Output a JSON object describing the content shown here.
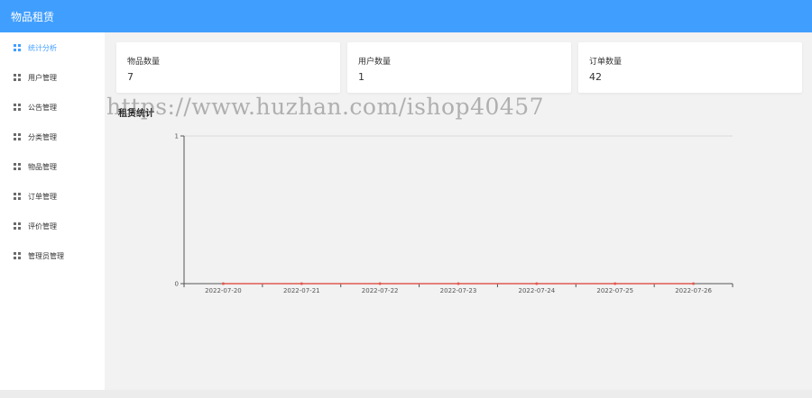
{
  "header": {
    "title": "物品租赁"
  },
  "sidebar": {
    "items": [
      {
        "label": "统计分析",
        "active": true,
        "icon": "grid-icon"
      },
      {
        "label": "用户管理",
        "active": false,
        "icon": "grid-icon"
      },
      {
        "label": "公告管理",
        "active": false,
        "icon": "grid-icon"
      },
      {
        "label": "分类管理",
        "active": false,
        "icon": "grid-icon"
      },
      {
        "label": "物品管理",
        "active": false,
        "icon": "grid-icon"
      },
      {
        "label": "订单管理",
        "active": false,
        "icon": "grid-icon"
      },
      {
        "label": "评价管理",
        "active": false,
        "icon": "grid-icon"
      },
      {
        "label": "管理员管理",
        "active": false,
        "icon": "grid-icon"
      }
    ]
  },
  "stats": [
    {
      "label": "物品数量",
      "value": "7"
    },
    {
      "label": "用户数量",
      "value": "1"
    },
    {
      "label": "订单数量",
      "value": "42"
    }
  ],
  "chart": {
    "title": "租赁统计"
  },
  "watermark": "https://www.huzhan.com/ishop40457",
  "colors": {
    "header": "#409eff",
    "line": "#e05a4f",
    "accent": "#409eff"
  },
  "chart_data": {
    "type": "line",
    "x": [
      "2022-07-20",
      "2022-07-21",
      "2022-07-22",
      "2022-07-23",
      "2022-07-24",
      "2022-07-25",
      "2022-07-26"
    ],
    "series": [
      {
        "values": [
          0,
          0,
          0,
          0,
          0,
          0,
          0
        ]
      }
    ],
    "yticks": [
      "0",
      "1"
    ],
    "ylim": [
      0,
      1
    ],
    "grid": "horizontal"
  }
}
